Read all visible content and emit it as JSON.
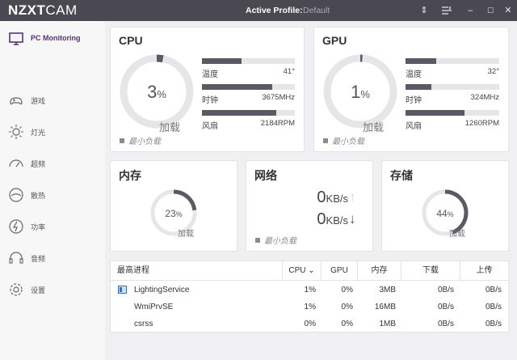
{
  "titlebar": {
    "brand_bold": "NZXT",
    "brand_light": "CAM",
    "profile_label": "Active Profile:",
    "profile_value": "Default"
  },
  "sidebar": {
    "items": [
      {
        "label": "PC Monitoring",
        "icon": "monitor-icon"
      },
      {
        "label": "游戏",
        "icon": "gamepad-icon"
      },
      {
        "label": "灯光",
        "icon": "sun-icon"
      },
      {
        "label": "超频",
        "icon": "speedometer-icon"
      },
      {
        "label": "散热",
        "icon": "fan-icon"
      },
      {
        "label": "功率",
        "icon": "power-icon"
      },
      {
        "label": "音频",
        "icon": "headset-icon"
      },
      {
        "label": "设置",
        "icon": "gear-icon"
      }
    ]
  },
  "cpu": {
    "title": "CPU",
    "value": "3",
    "unit": "%",
    "load_label": "加载",
    "min_load": "最小负载",
    "bars": [
      {
        "label": "温度",
        "value": "41°",
        "fill": 0.43
      },
      {
        "label": "时钟",
        "value": "3675MHz",
        "fill": 0.76
      },
      {
        "label": "风扇",
        "value": "2184RPM",
        "fill": 0.8
      }
    ]
  },
  "gpu": {
    "title": "GPU",
    "value": "1",
    "unit": "%",
    "load_label": "加载",
    "min_load": "最小负载",
    "bars": [
      {
        "label": "温度",
        "value": "32°",
        "fill": 0.33
      },
      {
        "label": "时钟",
        "value": "324MHz",
        "fill": 0.28
      },
      {
        "label": "风扇",
        "value": "1260RPM",
        "fill": 0.63
      }
    ]
  },
  "memory": {
    "title": "内存",
    "value": "23",
    "unit": "%",
    "load_label": "加载",
    "fill": 0.23
  },
  "network": {
    "title": "网络",
    "down_value": "0",
    "up_value": "0",
    "unit": "KB/s",
    "min_load": "最小负载"
  },
  "storage": {
    "title": "存储",
    "value": "44",
    "unit": "%",
    "load_label": "加载",
    "fill": 0.44
  },
  "processes": {
    "headers": [
      "最高进程",
      "CPU",
      "GPU",
      "内存",
      "下载",
      "上传"
    ],
    "rows": [
      {
        "name": "LightingService",
        "cpu": "1%",
        "gpu": "0%",
        "mem": "3MB",
        "down": "0B/s",
        "up": "0B/s"
      },
      {
        "name": "WmiPrvSE",
        "cpu": "1%",
        "gpu": "0%",
        "mem": "16MB",
        "down": "0B/s",
        "up": "0B/s"
      },
      {
        "name": "csrss",
        "cpu": "0%",
        "gpu": "0%",
        "mem": "1MB",
        "down": "0B/s",
        "up": "0B/s"
      }
    ]
  },
  "colors": {
    "accent": "#5a2d82",
    "titlebar": "#4a4952",
    "bar": "#5a5966",
    "ring_track": "#e6e6e9"
  }
}
